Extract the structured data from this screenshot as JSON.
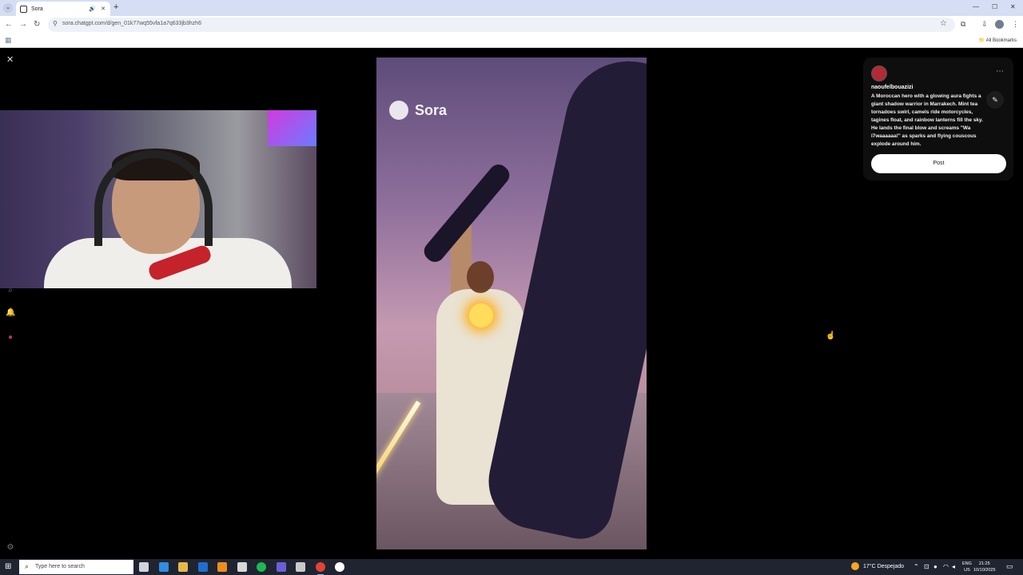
{
  "browser": {
    "tab_title": "Sora",
    "url": "sora.chatgpt.com/d/gen_01k77wq55vfa1a7q633jb3hzh6",
    "bookmarks_label": "All Bookmarks",
    "icons": {
      "back": "←",
      "forward": "→",
      "reload": "↻",
      "star": "☆",
      "sound": "🔊",
      "close_tab": "✕",
      "new_tab": "+",
      "lock": "⚲",
      "minimize": "—",
      "maximize": "☐",
      "close_window": "✕",
      "extensions": "⧉",
      "downloads": "⇩",
      "menu": "⋮",
      "apps": "▦",
      "folder": "📁",
      "tab_search": "⌄"
    }
  },
  "page": {
    "close_icon": "✕",
    "sidebar_icons": {
      "search": "⌕",
      "bell": "🔔",
      "profile": "●",
      "settings": "⚙"
    }
  },
  "video": {
    "watermark": "Sora"
  },
  "card": {
    "username": "naoufelbouazizi",
    "prompt": "A Moroccan hero with a glowing aura fights a giant shadow warrior in Marrakech. Mint tea tornadoes swirl, camels ride motorcycles, tagines float, and rainbow lanterns fill the sky. He lands the final blow and screams \"Wa l7waaaaaa!\" as sparks and flying couscous explode around him.",
    "post_label": "Post",
    "more_icon": "⋯",
    "edit_icon": "✎"
  },
  "taskbar": {
    "search_placeholder": "Type here to search",
    "search_icon": "⌕",
    "start_icon": "⊞",
    "weather_text": "17°C  Despejado",
    "lang_line1": "ENG",
    "lang_line2": "US",
    "time": "21:25",
    "date": "10/10/2025",
    "tray_chevron": "⌃",
    "notif_icon": "▭",
    "app_colors": [
      "#d0d4dc",
      "#2f8de4",
      "#e8b84a",
      "#1f6fd0",
      "#f08c1e",
      "#d8d8d8",
      "#1db954",
      "#6b5fd8",
      "#c9c9c9",
      "#e34234",
      "#ffffff"
    ]
  }
}
